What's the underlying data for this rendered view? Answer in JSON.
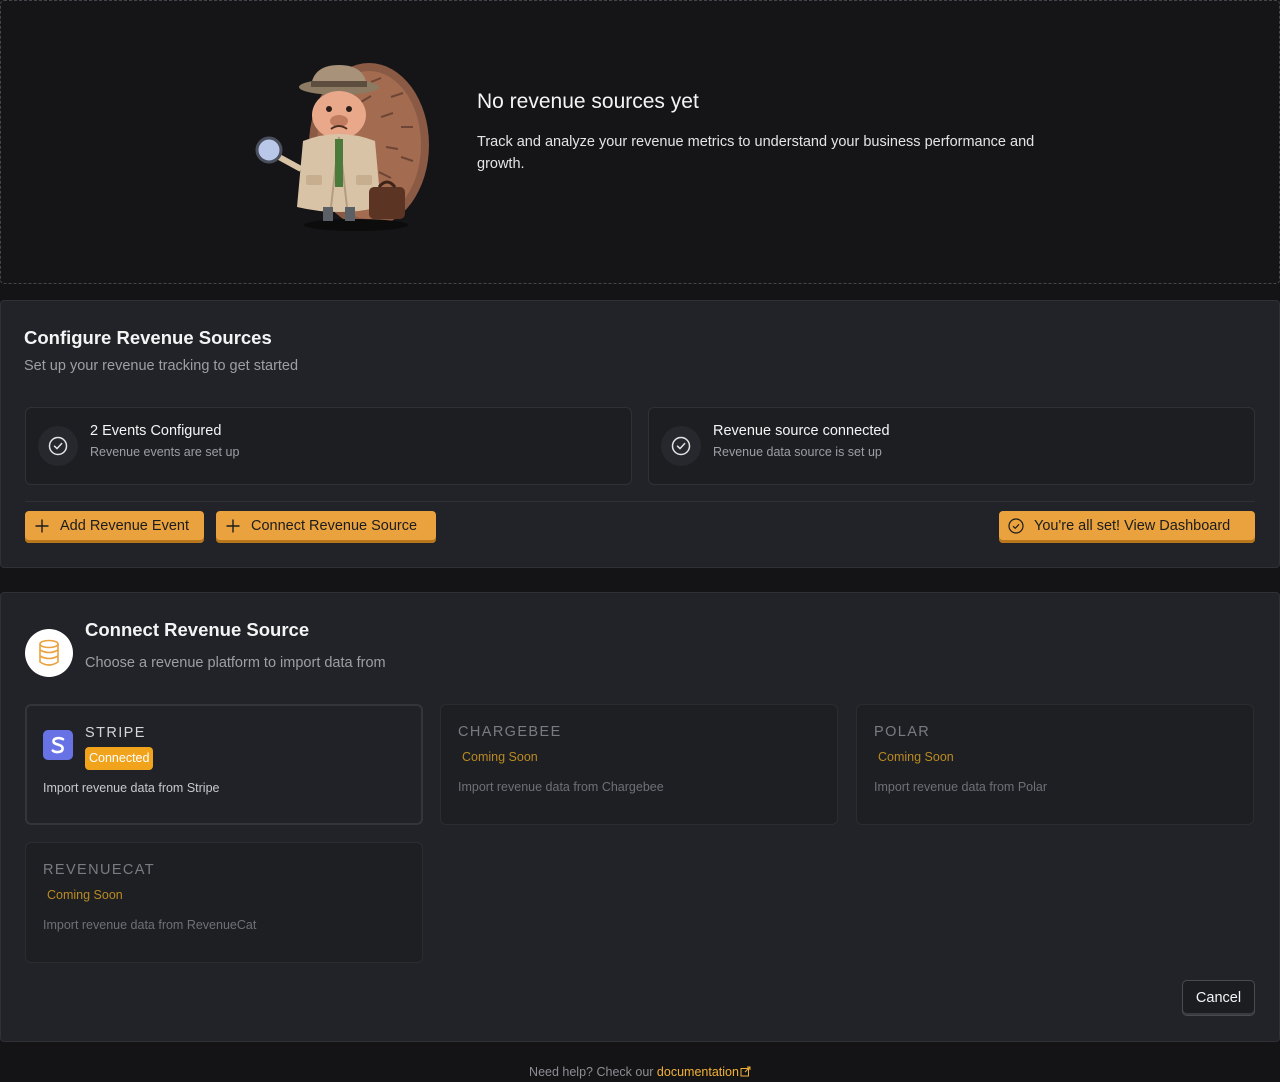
{
  "empty_state": {
    "title": "No revenue sources yet",
    "description": "Track and analyze your revenue metrics to understand your business performance and growth.",
    "illustration": "detective-hedgehog-illustration"
  },
  "configure": {
    "title": "Configure Revenue Sources",
    "subtitle": "Set up your revenue tracking to get started",
    "steps": [
      {
        "title": "2 Events Configured",
        "subtitle": "Revenue events are set up",
        "icon": "check-circle-icon"
      },
      {
        "title": "Revenue source connected",
        "subtitle": "Revenue data source is set up",
        "icon": "check-circle-icon"
      }
    ],
    "buttons": {
      "add_event": "Add Revenue Event",
      "connect_source": "Connect Revenue Source",
      "view_dashboard": "You're all set! View Dashboard"
    }
  },
  "connect": {
    "title": "Connect Revenue Source",
    "subtitle": "Choose a revenue platform to import data from",
    "icon": "database-icon",
    "providers": [
      {
        "name": "STRIPE",
        "status": "Connected",
        "description": "Import revenue data from Stripe"
      },
      {
        "name": "CHARGEBEE",
        "status": "Coming Soon",
        "description": "Import revenue data from Chargebee"
      },
      {
        "name": "POLAR",
        "status": "Coming Soon",
        "description": "Import revenue data from Polar"
      },
      {
        "name": "REVENUECAT",
        "status": "Coming Soon",
        "description": "Import revenue data from RevenueCat"
      }
    ],
    "cancel": "Cancel"
  },
  "help": {
    "prefix": "Need help? Check our",
    "link": "documentation"
  },
  "colors": {
    "accent": "#e9a23d",
    "badge": "#f2a31c",
    "stripe": "#6772e5",
    "background": "#141416",
    "card": "#222328"
  }
}
